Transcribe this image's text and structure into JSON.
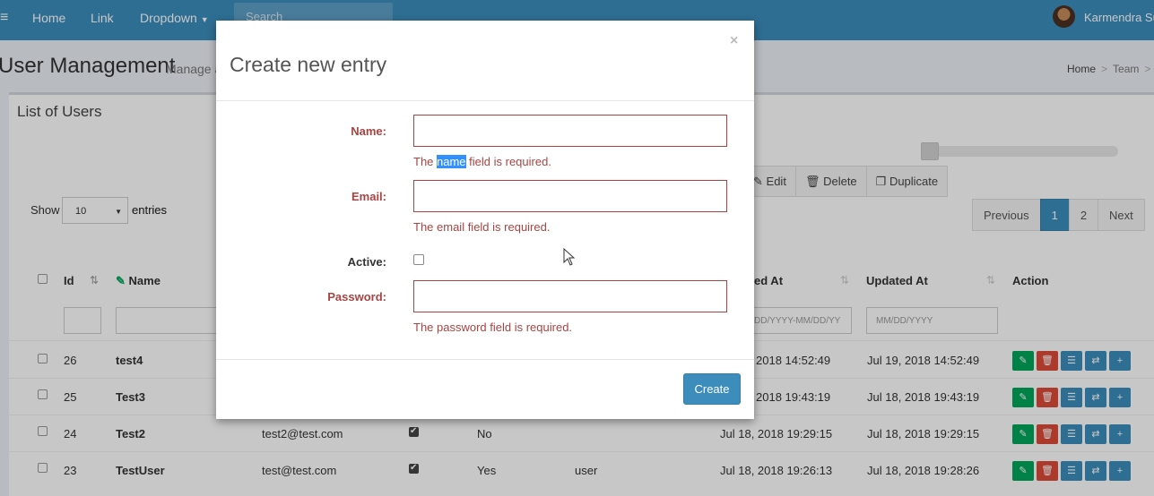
{
  "navbar": {
    "menu_icon": "hamburger-icon",
    "links": [
      "Home",
      "Link",
      "Dropdown"
    ],
    "search_placeholder": "Search",
    "user_name": "Karmendra Su"
  },
  "page": {
    "title": "User Management",
    "subtitle": "Manage a",
    "breadcrumb": [
      "Home",
      "Team"
    ]
  },
  "box": {
    "title": "List of Users",
    "toolbar": {
      "edit": "Edit",
      "delete": "Delete",
      "duplicate": "Duplicate"
    },
    "show_label": "Show",
    "show_value": "10",
    "entries_label": "entries",
    "pagination": {
      "previous": "Previous",
      "pages": [
        "1",
        "2"
      ],
      "next": "Next",
      "active_page": "1"
    }
  },
  "table": {
    "headers": {
      "id": "Id",
      "name": "Name",
      "created_at": "ed At",
      "updated_at": "Updated At",
      "action": "Action"
    },
    "filters": {
      "created_placeholder": "DD/YYYY-MM/DD/YY",
      "updated_placeholder": "MM/DD/YYYY"
    },
    "rows": [
      {
        "id": "26",
        "name": "test4",
        "email": "",
        "active": false,
        "verified": "",
        "role": "",
        "created": "2018 14:52:49",
        "updated": "Jul 19, 2018 14:52:49"
      },
      {
        "id": "25",
        "name": "Test3",
        "email": "",
        "active": false,
        "verified": "",
        "role": "",
        "created": "2018 19:43:19",
        "updated": "Jul 18, 2018 19:43:19"
      },
      {
        "id": "24",
        "name": "Test2",
        "email": "test2@test.com",
        "active": true,
        "verified": "No",
        "role": "",
        "created": "Jul 18, 2018 19:29:15",
        "updated": "Jul 18, 2018 19:29:15"
      },
      {
        "id": "23",
        "name": "TestUser",
        "email": "test@test.com",
        "active": true,
        "verified": "Yes",
        "role": "user",
        "created": "Jul 18, 2018 19:26:13",
        "updated": "Jul 18, 2018 19:28:26"
      }
    ]
  },
  "modal": {
    "title": "Create new entry",
    "close": "×",
    "fields": {
      "name_label": "Name:",
      "name_error_pre": "The ",
      "name_error_hl": "name",
      "name_error_post": " field is required.",
      "email_label": "Email:",
      "email_error": "The email field is required.",
      "active_label": "Active:",
      "password_label": "Password:",
      "password_error": "The password field is required."
    },
    "create_button": "Create"
  },
  "colors": {
    "primary": "#3c8dbc",
    "error": "#a94442",
    "success": "#00a65a",
    "danger": "#dd4b39"
  }
}
